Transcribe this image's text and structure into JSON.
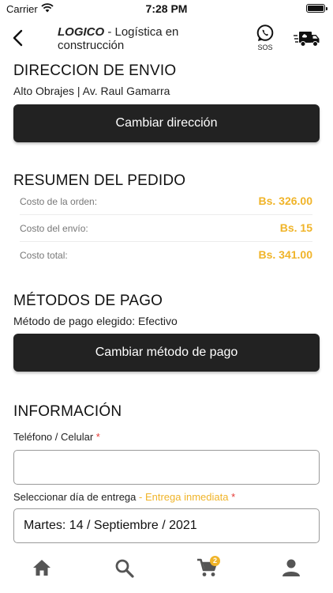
{
  "status_bar": {
    "carrier": "Carrier",
    "time": "7:28 PM"
  },
  "header": {
    "brand": "LOGICO",
    "title_rest": " - Logística en construcción",
    "sos_label": "SOS"
  },
  "shipping": {
    "title": "DIRECCION DE ENVIO",
    "address": "Alto Obrajes | Av. Raul Gamarra",
    "button_label": "Cambiar dirección"
  },
  "summary": {
    "title": "RESUMEN DEL PEDIDO",
    "rows": [
      {
        "label": "Costo de la orden:",
        "value": "Bs. 326.00"
      },
      {
        "label": "Costo del envío:",
        "value": "Bs. 15"
      },
      {
        "label": "Costo total:",
        "value": "Bs. 341.00"
      }
    ]
  },
  "payment": {
    "title": "MÉTODOS DE PAGO",
    "chosen_text": "Método de pago elegido: Efectivo",
    "button_label": "Cambiar método de pago"
  },
  "info": {
    "title": "INFORMACIÓN",
    "phone_label": "Teléfono / Celular",
    "phone_value": "",
    "required_mark": "*",
    "delivery_label": "Seleccionar día de entrega",
    "delivery_hint": "- Entrega inmediata",
    "delivery_value": "Martes: 14 / Septiembre / 2021"
  },
  "tab_bar": {
    "items": [
      "home-icon",
      "search-icon",
      "cart-icon",
      "person-icon"
    ],
    "cart_count": "2"
  },
  "colors": {
    "accent": "#f0b429",
    "button_dark": "#222222",
    "required": "#e53935"
  }
}
